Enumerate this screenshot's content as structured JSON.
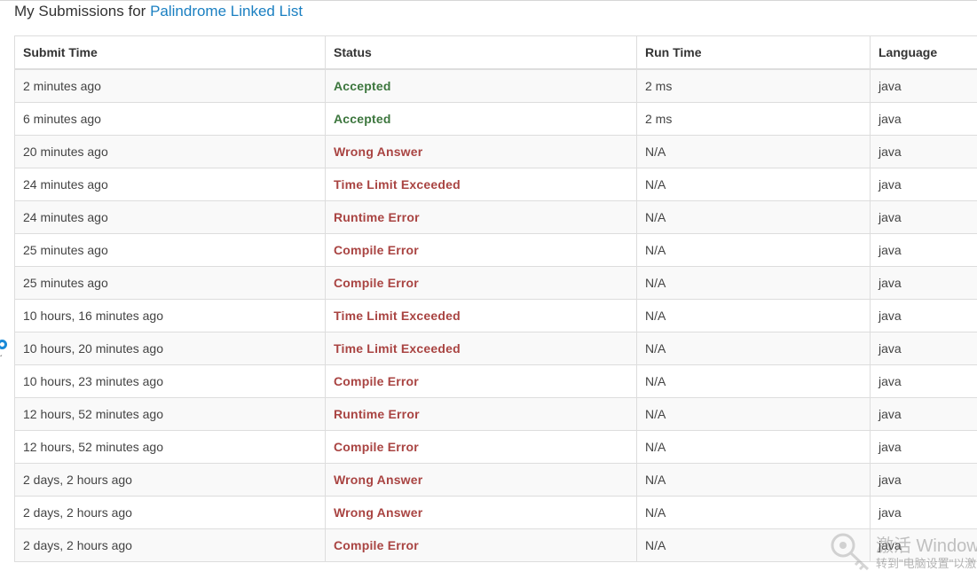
{
  "page": {
    "title_prefix": "My Submissions for",
    "problem_name": "Palindrome Linked List"
  },
  "table": {
    "headers": {
      "submit_time": "Submit Time",
      "status": "Status",
      "run_time": "Run Time",
      "language": "Language"
    },
    "rows": [
      {
        "submit_time": "2 minutes ago",
        "status": "Accepted",
        "status_type": "ok",
        "run_time": "2 ms",
        "language": "java"
      },
      {
        "submit_time": "6 minutes ago",
        "status": "Accepted",
        "status_type": "ok",
        "run_time": "2 ms",
        "language": "java"
      },
      {
        "submit_time": "20 minutes ago",
        "status": "Wrong Answer",
        "status_type": "bad",
        "run_time": "N/A",
        "language": "java"
      },
      {
        "submit_time": "24 minutes ago",
        "status": "Time Limit Exceeded",
        "status_type": "bad",
        "run_time": "N/A",
        "language": "java"
      },
      {
        "submit_time": "24 minutes ago",
        "status": "Runtime Error",
        "status_type": "bad",
        "run_time": "N/A",
        "language": "java"
      },
      {
        "submit_time": "25 minutes ago",
        "status": "Compile Error",
        "status_type": "bad",
        "run_time": "N/A",
        "language": "java"
      },
      {
        "submit_time": "25 minutes ago",
        "status": "Compile Error",
        "status_type": "bad",
        "run_time": "N/A",
        "language": "java"
      },
      {
        "submit_time": "10 hours, 16 minutes ago",
        "status": "Time Limit Exceeded",
        "status_type": "bad",
        "run_time": "N/A",
        "language": "java"
      },
      {
        "submit_time": "10 hours, 20 minutes ago",
        "status": "Time Limit Exceeded",
        "status_type": "bad",
        "run_time": "N/A",
        "language": "java"
      },
      {
        "submit_time": "10 hours, 23 minutes ago",
        "status": "Compile Error",
        "status_type": "bad",
        "run_time": "N/A",
        "language": "java"
      },
      {
        "submit_time": "12 hours, 52 minutes ago",
        "status": "Runtime Error",
        "status_type": "bad",
        "run_time": "N/A",
        "language": "java"
      },
      {
        "submit_time": "12 hours, 52 minutes ago",
        "status": "Compile Error",
        "status_type": "bad",
        "run_time": "N/A",
        "language": "java"
      },
      {
        "submit_time": "2 days, 2 hours ago",
        "status": "Wrong Answer",
        "status_type": "bad",
        "run_time": "N/A",
        "language": "java"
      },
      {
        "submit_time": "2 days, 2 hours ago",
        "status": "Wrong Answer",
        "status_type": "bad",
        "run_time": "N/A",
        "language": "java"
      },
      {
        "submit_time": "2 days, 2 hours ago",
        "status": "Compile Error",
        "status_type": "bad",
        "run_time": "N/A",
        "language": "java"
      }
    ]
  },
  "colors": {
    "accepted": "#3c763d",
    "error": "#a94442",
    "link": "#1a7fc1",
    "stripe": "#f9f9f9",
    "border": "#dddddd"
  },
  "overlay": {
    "watermark_line1": "激活 Windows",
    "watermark_line2": "转到\"电脑设置\"以激活",
    "watermark_icon": "key-icon",
    "side_marker_icon": "circle-marker-icon"
  }
}
